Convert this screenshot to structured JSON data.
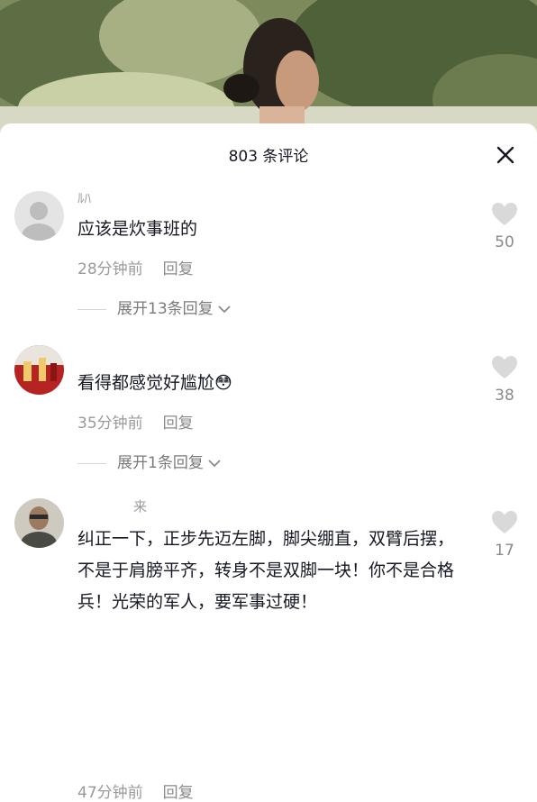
{
  "header": {
    "title": "803 条评论"
  },
  "comments": [
    {
      "username": "ﾙﾊ",
      "text": "应该是炊事班的",
      "time": "28分钟前",
      "reply_label": "回复",
      "likes": "50",
      "expand_label": "展开13条回复"
    },
    {
      "username": "",
      "text": "看得都感觉好尴尬😳",
      "time": "35分钟前",
      "reply_label": "回复",
      "likes": "38",
      "expand_label": "展开1条回复"
    },
    {
      "username": "来",
      "text": "纠正一下，正步先迈左脚，脚尖绷直，双臂后摆，不是于肩膀平齐，转身不是双脚一块！你不是合格兵！光荣的军人，要军事过硬！",
      "time": "47分钟前",
      "reply_label": "回复",
      "likes": "17"
    }
  ],
  "icons": {
    "close": "close-icon",
    "like": "heart-icon",
    "expand": "chevron-down-icon"
  },
  "colors": {
    "primary_text": "#161823",
    "secondary_text": "#9a9a9a",
    "heart": "#d9d9d9"
  }
}
